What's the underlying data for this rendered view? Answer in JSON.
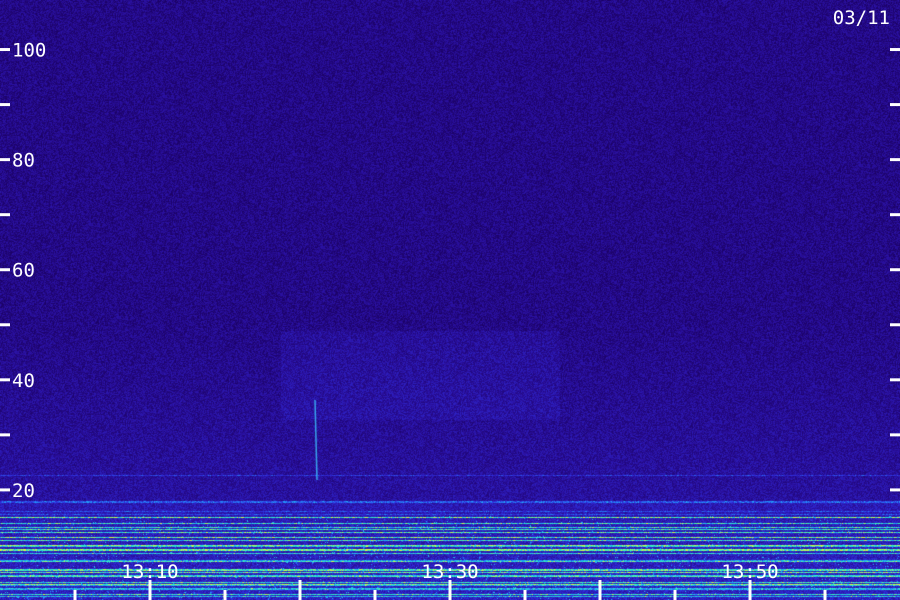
{
  "date_label": "03/11",
  "chart_data": {
    "type": "heatmap",
    "title": "",
    "xlabel": "",
    "ylabel": "",
    "y_ticks_labeled": [
      "100",
      "80",
      "60",
      "40",
      "20"
    ],
    "y_tick_values": [
      100,
      90,
      80,
      70,
      60,
      50,
      40,
      30,
      20
    ],
    "ylim": [
      0,
      109
    ],
    "x_tick_labels": [
      "13:10",
      "13:30",
      "13:50"
    ],
    "x_tick_minutes": [
      10,
      30,
      50
    ],
    "xlim_minutes": [
      0,
      60
    ],
    "x_minor_step_minutes": 5,
    "colormap": [
      "#1a0060",
      "#2a10a0",
      "#3030e0",
      "#20a0ff",
      "#30ffc0",
      "#e0ff40"
    ],
    "grid": false
  }
}
